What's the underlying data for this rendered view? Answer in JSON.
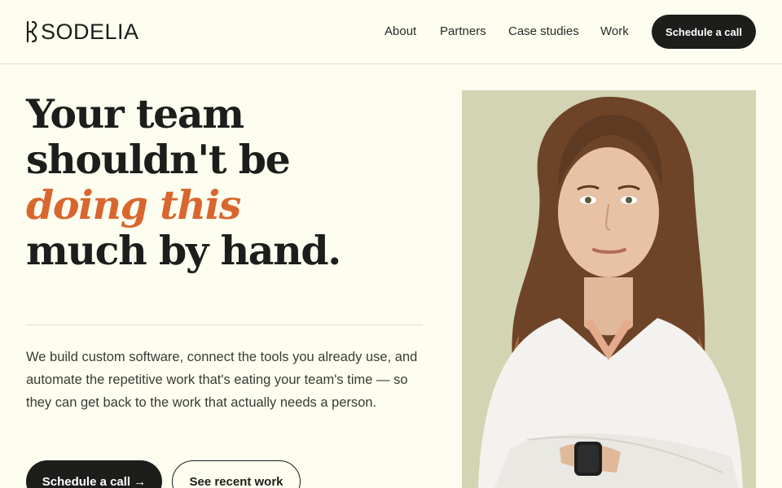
{
  "brand": {
    "name": "SODELIA",
    "logo_icon": "sodelia-logo-mark"
  },
  "nav": {
    "items": [
      {
        "label": "About"
      },
      {
        "label": "Partners"
      },
      {
        "label": "Case studies"
      },
      {
        "label": "Work"
      }
    ],
    "cta_label": "Schedule a call"
  },
  "hero": {
    "headline": {
      "line1": "Your team",
      "line2": "shouldn't be",
      "line3_accent": "doing this",
      "line4": "much by hand."
    },
    "description": "We build custom software, connect the tools you already use, and automate the repetitive work that's eating your team's time — so they can get back to the work that actually needs a person.",
    "primary_cta": "Schedule a call →",
    "secondary_cta": "See recent work",
    "image": "portrait-woman-crossed-arms"
  },
  "colors": {
    "background": "#fefef0",
    "ink": "#1d1d1b",
    "accent": "#d9662e",
    "photo_bg": "#d3d4b3"
  }
}
